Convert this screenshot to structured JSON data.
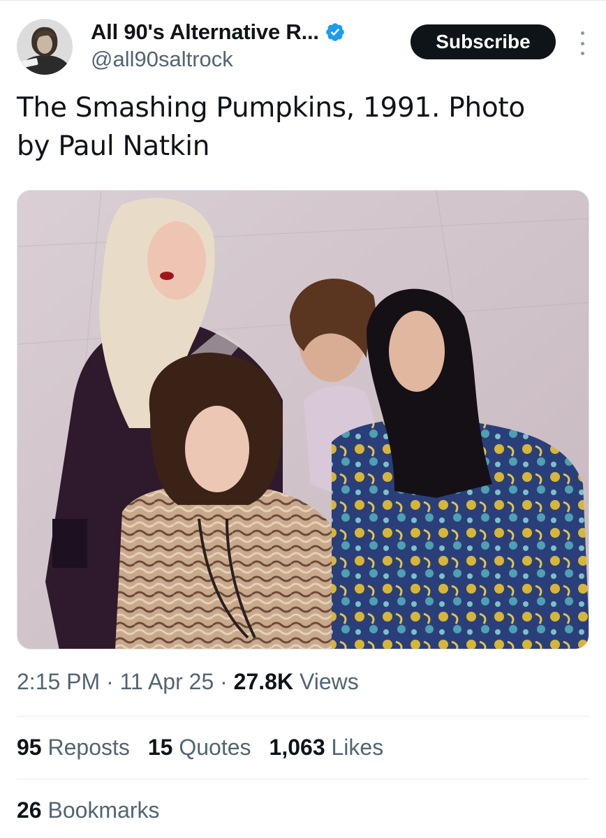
{
  "author": {
    "display_name": "All 90's Alternative R...",
    "handle": "@all90saltrock",
    "verified": true,
    "verified_color": "#1d9bf0",
    "avatar_icon": "avatar-portrait"
  },
  "subscribe_label": "Subscribe",
  "more_icon": "more-vertical-icon",
  "tweet": {
    "text": "The Smashing Pumpkins, 1991. Photo by Paul Natkin",
    "photo_icon": "band-photo"
  },
  "meta": {
    "time": "2:15 PM",
    "sep1": " · ",
    "date": "11 Apr 25",
    "sep2": " · ",
    "views_count": "27.8K",
    "views_label": " Views"
  },
  "stats": {
    "reposts_count": "95",
    "reposts_label": " Reposts",
    "quotes_count": "15",
    "quotes_label": " Quotes",
    "likes_count": "1,063",
    "likes_label": " Likes",
    "bookmarks_count": "26",
    "bookmarks_label": " Bookmarks"
  },
  "colors": {
    "text_primary": "#0f1419",
    "text_secondary": "#536471",
    "button_bg": "#0f1419",
    "divider": "#e6e9ec"
  }
}
